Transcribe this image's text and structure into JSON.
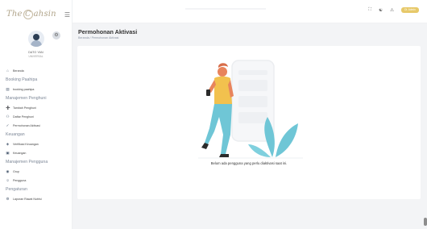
{
  "brand": {
    "logo_text_left": "The",
    "logo_text_c": "C",
    "logo_text_right": "ahsin"
  },
  "profile": {
    "name": "DATO YAN",
    "role": "UNIVERSAL"
  },
  "sidebar": {
    "items": [
      {
        "type": "item",
        "icon": "home-icon",
        "label": "Beranda"
      },
      {
        "type": "section",
        "label": "Booking Paahipa"
      },
      {
        "type": "item",
        "icon": "file-icon",
        "label": "booking paahipa"
      },
      {
        "type": "section",
        "label": "Manajemen Penghuni"
      },
      {
        "type": "item",
        "icon": "user-plus-icon",
        "label": "Tambah Penghuni"
      },
      {
        "type": "item",
        "icon": "users-icon",
        "label": "Daftar Penghuni"
      },
      {
        "type": "item",
        "icon": "user-check-icon",
        "label": "Permohonan Aktivasi"
      },
      {
        "type": "section",
        "label": "Keuangan"
      },
      {
        "type": "item",
        "icon": "shield-icon",
        "label": "Verifikasi Keuangan"
      },
      {
        "type": "item",
        "icon": "wallet-icon",
        "label": "Keuangan"
      },
      {
        "type": "section",
        "label": "Manajemen Pengguna"
      },
      {
        "type": "item",
        "icon": "group-icon",
        "label": "Grup"
      },
      {
        "type": "item",
        "icon": "user-icon",
        "label": "Pengguna"
      },
      {
        "type": "section",
        "label": "Pengaturan"
      },
      {
        "type": "item",
        "icon": "settings-icon",
        "label": "Laporan Rawat Nutrisi"
      }
    ]
  },
  "topbar": {
    "user_label": "Di. Admin"
  },
  "main": {
    "title": "Permohonan Aktivasi",
    "breadcrumb": "Beranda / Permohonan Aktivasi",
    "empty_message": "Belum ada pengguna yang perlu diaktivasi saat ini."
  },
  "colors": {
    "accent": "#e7c96a",
    "plant": "#6fc6d6",
    "shirt": "#f2c14e",
    "skin": "#e8845c"
  }
}
